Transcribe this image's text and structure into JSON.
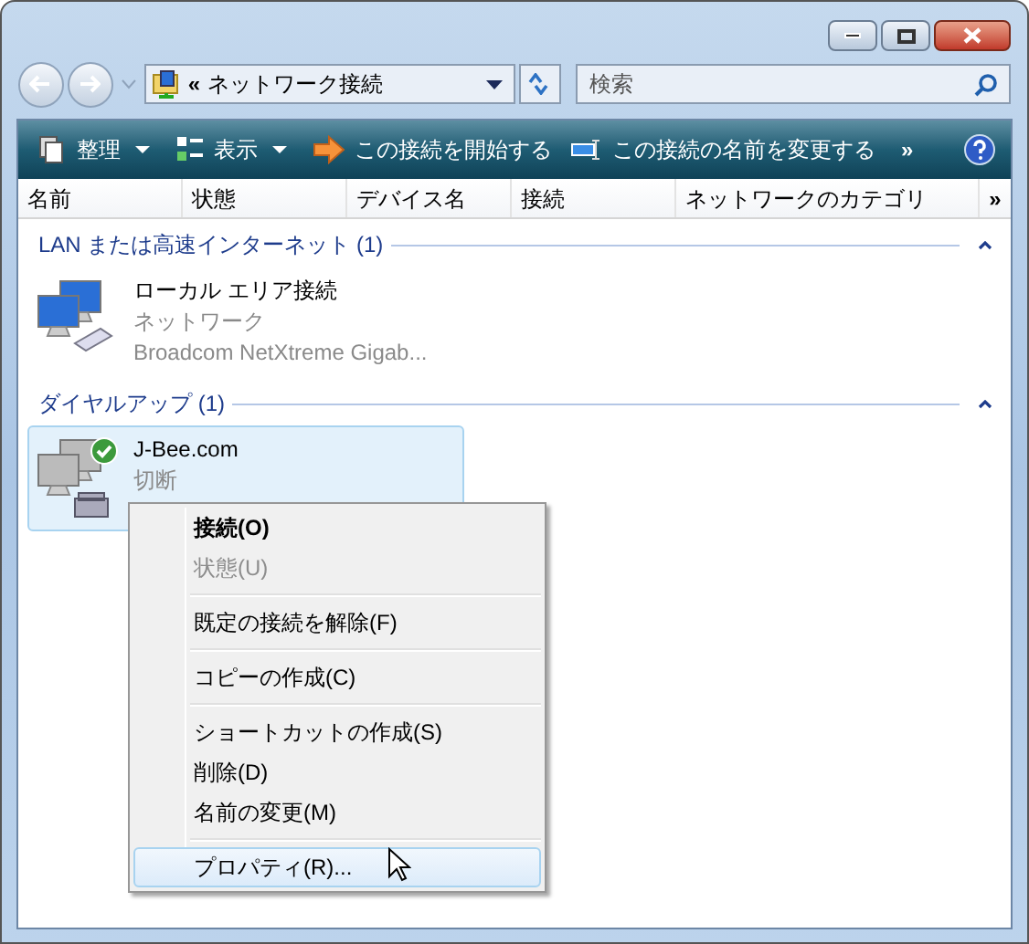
{
  "address": {
    "prefix": "«",
    "path": "ネットワーク接続"
  },
  "search": {
    "placeholder": "検索"
  },
  "toolbar": {
    "items": [
      {
        "label": "整理",
        "kind": "organize"
      },
      {
        "label": "表示",
        "kind": "views"
      },
      {
        "label": "この接続を開始する",
        "kind": "start"
      },
      {
        "label": "この接続の名前を変更する",
        "kind": "rename"
      }
    ],
    "overflow": "»"
  },
  "columns": {
    "items": [
      "名前",
      "状態",
      "デバイス名",
      "接続",
      "ネットワークのカテゴリ"
    ],
    "overflow": "»"
  },
  "groups": [
    {
      "title": "LAN または高速インターネット (1)",
      "expanded": true,
      "items": [
        {
          "kind": "lan",
          "name": "ローカル エリア接続",
          "lines": [
            "ネットワーク",
            "Broadcom NetXtreme Gigab..."
          ],
          "selected": false,
          "default": false
        }
      ]
    },
    {
      "title": "ダイヤルアップ (1)",
      "expanded": true,
      "items": [
        {
          "kind": "dialup",
          "name": "J-Bee.com",
          "lines": [
            "切断"
          ],
          "selected": true,
          "default": true
        }
      ]
    }
  ],
  "context_menu": {
    "sections": [
      [
        {
          "label": "接続(O)",
          "bold": true,
          "disabled": false,
          "selected": false
        },
        {
          "label": "状態(U)",
          "bold": false,
          "disabled": true,
          "selected": false
        }
      ],
      [
        {
          "label": "既定の接続を解除(F)",
          "bold": false,
          "disabled": false,
          "selected": false
        }
      ],
      [
        {
          "label": "コピーの作成(C)",
          "bold": false,
          "disabled": false,
          "selected": false
        }
      ],
      [
        {
          "label": "ショートカットの作成(S)",
          "bold": false,
          "disabled": false,
          "selected": false
        },
        {
          "label": "削除(D)",
          "bold": false,
          "disabled": false,
          "selected": false
        },
        {
          "label": "名前の変更(M)",
          "bold": false,
          "disabled": false,
          "selected": false
        }
      ],
      [
        {
          "label": "プロパティ(R)...",
          "bold": false,
          "disabled": false,
          "selected": true
        }
      ]
    ]
  }
}
